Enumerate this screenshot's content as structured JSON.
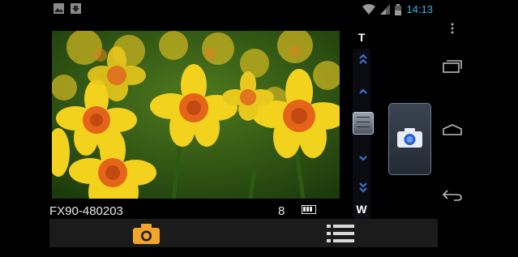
{
  "status_bar": {
    "time": "14:13",
    "icons": [
      "image-notification-icon",
      "download-notification-icon",
      "wifi-icon",
      "signal-icon",
      "battery-icon"
    ]
  },
  "camera": {
    "model": "FX90-480203",
    "shots_remaining": "8",
    "zoom_tele_label": "T",
    "zoom_wide_label": "W"
  },
  "toolbar": {
    "camera_icon": "camera-icon",
    "menu_icon": "list-icon"
  },
  "nav": {
    "overflow": "overflow-menu-icon",
    "recent": "recent-apps-icon",
    "home": "home-icon",
    "back": "back-icon"
  },
  "colors": {
    "clock": "#33b5e5",
    "accent_camera": "#f3a529",
    "zoom_arrows": "#3a7be0"
  }
}
